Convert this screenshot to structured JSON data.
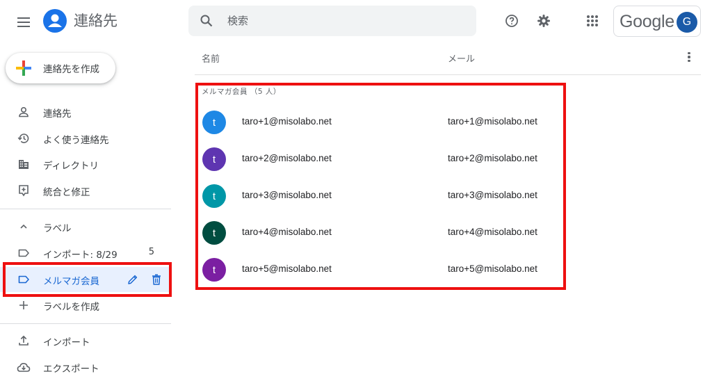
{
  "header": {
    "app_title": "連絡先",
    "search_placeholder": "検索",
    "google_label": "Google",
    "account_initial": "G"
  },
  "sidebar": {
    "create_label": "連絡先を作成",
    "items": [
      {
        "label": "連絡先",
        "icon": "person-icon"
      },
      {
        "label": "よく使う連絡先",
        "icon": "history-icon"
      },
      {
        "label": "ディレクトリ",
        "icon": "building-icon"
      },
      {
        "label": "統合と修正",
        "icon": "merge-icon"
      }
    ],
    "labels_section": "ラベル",
    "label_items": [
      {
        "label": "インポート: 8/29",
        "count": "5",
        "icon": "label-icon"
      },
      {
        "label": "メルマガ会員",
        "icon": "label-icon",
        "selected": true
      }
    ],
    "create_label_item": "ラベルを作成",
    "bottom_items": [
      {
        "label": "インポート",
        "icon": "upload-icon"
      },
      {
        "label": "エクスポート",
        "icon": "cloud-download-icon"
      }
    ]
  },
  "main": {
    "columns": {
      "name": "名前",
      "email": "メール"
    },
    "group_title": "メルマガ会員 （5 人）",
    "contacts": [
      {
        "initial": "t",
        "name": "taro+1@misolabo.net",
        "email": "taro+1@misolabo.net",
        "color": "#1e88e5"
      },
      {
        "initial": "t",
        "name": "taro+2@misolabo.net",
        "email": "taro+2@misolabo.net",
        "color": "#5e35b1"
      },
      {
        "initial": "t",
        "name": "taro+3@misolabo.net",
        "email": "taro+3@misolabo.net",
        "color": "#0097a7"
      },
      {
        "initial": "t",
        "name": "taro+4@misolabo.net",
        "email": "taro+4@misolabo.net",
        "color": "#004d40"
      },
      {
        "initial": "t",
        "name": "taro+5@misolabo.net",
        "email": "taro+5@misolabo.net",
        "color": "#7b1fa2"
      }
    ]
  },
  "colors": {
    "accent": "#1a73e8",
    "selected_bg": "#e8f0fe",
    "highlight_red": "#ee1010"
  }
}
